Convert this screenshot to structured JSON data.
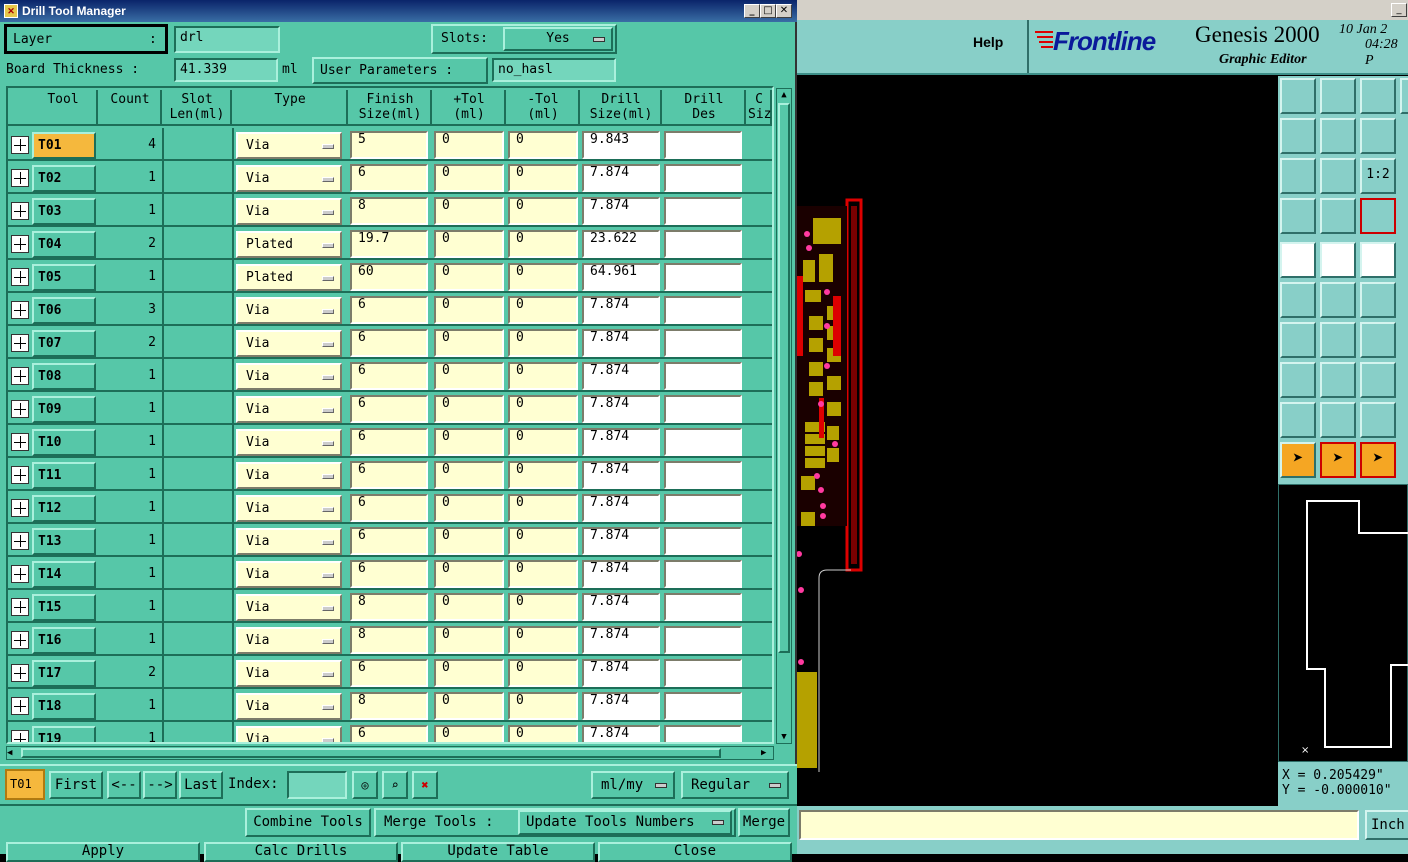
{
  "window": {
    "title": "Drill Tool Manager",
    "min": "_",
    "max": "□",
    "close": "✕"
  },
  "header": {
    "layer_label": "Layer",
    "layer_colon": ":",
    "layer_value": "drl",
    "slots_label": "Slots:",
    "slots_value": "Yes",
    "board_thickness_label": "Board Thickness :",
    "board_thickness_value": "41.339",
    "board_thickness_unit": "ml",
    "user_params_label": "User Parameters :",
    "user_params_value": "no_hasl"
  },
  "columns": [
    "Tool",
    "Count",
    "Slot\nLen(ml)",
    "Type",
    "Finish\nSize(ml)",
    "+Tol\n(ml)",
    "-Tol\n(ml)",
    "Drill\nSize(ml)",
    "Drill\nDes",
    "C\nSiz"
  ],
  "rows": [
    {
      "tool": "T01",
      "count": "4",
      "type": "Via",
      "finish": "5",
      "ptol": "0",
      "mtol": "0",
      "drill": "9.843",
      "des": ""
    },
    {
      "tool": "T02",
      "count": "1",
      "type": "Via",
      "finish": "6",
      "ptol": "0",
      "mtol": "0",
      "drill": "7.874",
      "des": ""
    },
    {
      "tool": "T03",
      "count": "1",
      "type": "Via",
      "finish": "8",
      "ptol": "0",
      "mtol": "0",
      "drill": "7.874",
      "des": ""
    },
    {
      "tool": "T04",
      "count": "2",
      "type": "Plated",
      "finish": "19.7",
      "ptol": "0",
      "mtol": "0",
      "drill": "23.622",
      "des": ""
    },
    {
      "tool": "T05",
      "count": "1",
      "type": "Plated",
      "finish": "60",
      "ptol": "0",
      "mtol": "0",
      "drill": "64.961",
      "des": ""
    },
    {
      "tool": "T06",
      "count": "3",
      "type": "Via",
      "finish": "6",
      "ptol": "0",
      "mtol": "0",
      "drill": "7.874",
      "des": ""
    },
    {
      "tool": "T07",
      "count": "2",
      "type": "Via",
      "finish": "6",
      "ptol": "0",
      "mtol": "0",
      "drill": "7.874",
      "des": ""
    },
    {
      "tool": "T08",
      "count": "1",
      "type": "Via",
      "finish": "6",
      "ptol": "0",
      "mtol": "0",
      "drill": "7.874",
      "des": ""
    },
    {
      "tool": "T09",
      "count": "1",
      "type": "Via",
      "finish": "6",
      "ptol": "0",
      "mtol": "0",
      "drill": "7.874",
      "des": ""
    },
    {
      "tool": "T10",
      "count": "1",
      "type": "Via",
      "finish": "6",
      "ptol": "0",
      "mtol": "0",
      "drill": "7.874",
      "des": ""
    },
    {
      "tool": "T11",
      "count": "1",
      "type": "Via",
      "finish": "6",
      "ptol": "0",
      "mtol": "0",
      "drill": "7.874",
      "des": ""
    },
    {
      "tool": "T12",
      "count": "1",
      "type": "Via",
      "finish": "6",
      "ptol": "0",
      "mtol": "0",
      "drill": "7.874",
      "des": ""
    },
    {
      "tool": "T13",
      "count": "1",
      "type": "Via",
      "finish": "6",
      "ptol": "0",
      "mtol": "0",
      "drill": "7.874",
      "des": ""
    },
    {
      "tool": "T14",
      "count": "1",
      "type": "Via",
      "finish": "6",
      "ptol": "0",
      "mtol": "0",
      "drill": "7.874",
      "des": ""
    },
    {
      "tool": "T15",
      "count": "1",
      "type": "Via",
      "finish": "8",
      "ptol": "0",
      "mtol": "0",
      "drill": "7.874",
      "des": ""
    },
    {
      "tool": "T16",
      "count": "1",
      "type": "Via",
      "finish": "8",
      "ptol": "0",
      "mtol": "0",
      "drill": "7.874",
      "des": ""
    },
    {
      "tool": "T17",
      "count": "2",
      "type": "Via",
      "finish": "6",
      "ptol": "0",
      "mtol": "0",
      "drill": "7.874",
      "des": ""
    },
    {
      "tool": "T18",
      "count": "1",
      "type": "Via",
      "finish": "8",
      "ptol": "0",
      "mtol": "0",
      "drill": "7.874",
      "des": ""
    },
    {
      "tool": "T19",
      "count": "1",
      "type": "Via",
      "finish": "6",
      "ptol": "0",
      "mtol": "0",
      "drill": "7.874",
      "des": ""
    }
  ],
  "nav": {
    "current": "T01",
    "first": "First",
    "prev": "<--",
    "next": "-->",
    "last": "Last",
    "index_label": "Index:",
    "units": "ml/my",
    "mode": "Regular"
  },
  "actions": {
    "combine": "Combine Tools",
    "merge_label": "Merge Tools :",
    "update_numbers": "Update Tools Numbers",
    "merge": "Merge",
    "apply": "Apply",
    "calc": "Calc Drills",
    "update_table": "Update Table",
    "close": "Close"
  },
  "genesis": {
    "help": "Help",
    "logo": "Frontline",
    "product": "Genesis 2000",
    "subtitle": "Graphic Editor",
    "date": "10 Jan 2",
    "time": "04:28 P",
    "x_readout": "X = 0.205429\"",
    "y_readout": "Y = -0.000010\"",
    "units_button": "Inch"
  },
  "colors": {
    "panel": "#56c7a8",
    "yellow_field": "#ffffd2",
    "selected_tool": "#f5b83d",
    "pad": "#b5a100",
    "trace": "#e00000"
  }
}
